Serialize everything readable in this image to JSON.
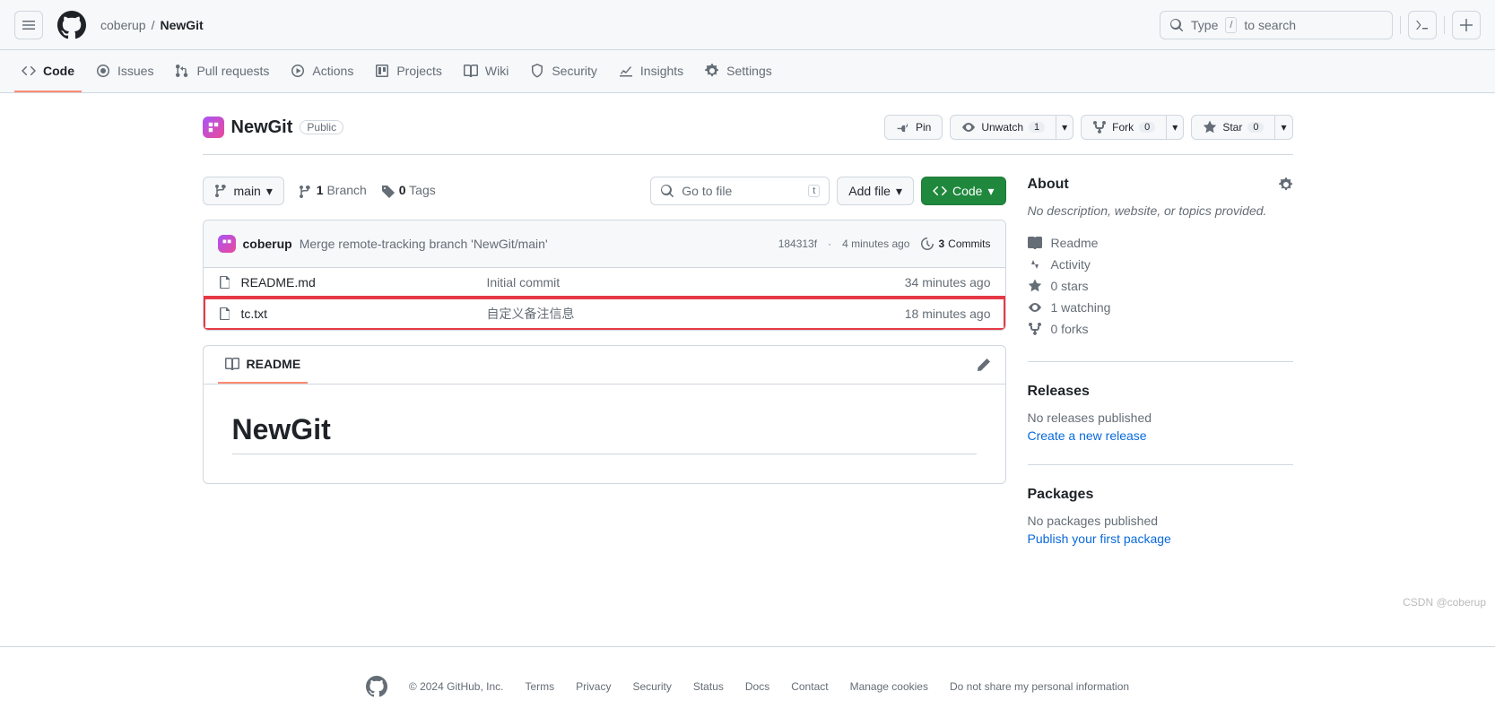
{
  "header": {
    "owner": "coberup",
    "repo": "NewGit",
    "search_placeholder": "Type",
    "search_hint": "to search",
    "search_kbd": "/"
  },
  "tabs": {
    "code": "Code",
    "issues": "Issues",
    "pulls": "Pull requests",
    "actions": "Actions",
    "projects": "Projects",
    "wiki": "Wiki",
    "security": "Security",
    "insights": "Insights",
    "settings": "Settings"
  },
  "repo": {
    "name": "NewGit",
    "visibility": "Public"
  },
  "repoActions": {
    "pin": "Pin",
    "unwatch": "Unwatch",
    "unwatch_count": "1",
    "fork": "Fork",
    "fork_count": "0",
    "star": "Star",
    "star_count": "0"
  },
  "branchBar": {
    "branch": "main",
    "branches_count": "1",
    "branches_label": "Branch",
    "tags_count": "0",
    "tags_label": "Tags",
    "goto_placeholder": "Go to file",
    "goto_kbd": "t",
    "add_file": "Add file",
    "code_btn": "Code"
  },
  "commitBar": {
    "author": "coberup",
    "message": "Merge remote-tracking branch 'NewGit/main'",
    "sha": "184313f",
    "time": "4 minutes ago",
    "commits_count": "3",
    "commits_label": "Commits"
  },
  "files": [
    {
      "name": "README.md",
      "message": "Initial commit",
      "time": "34 minutes ago",
      "highlight": false
    },
    {
      "name": "tc.txt",
      "message": "自定义备注信息",
      "time": "18 minutes ago",
      "highlight": true
    }
  ],
  "readme": {
    "tab_label": "README",
    "heading": "NewGit"
  },
  "sidebar": {
    "about_title": "About",
    "about_desc": "No description, website, or topics provided.",
    "links": {
      "readme": "Readme",
      "activity": "Activity",
      "stars": "0 stars",
      "watching": "1 watching",
      "forks": "0 forks"
    },
    "releases_title": "Releases",
    "releases_empty": "No releases published",
    "releases_action": "Create a new release",
    "packages_title": "Packages",
    "packages_empty": "No packages published",
    "packages_action": "Publish your first package"
  },
  "footer": {
    "copyright": "© 2024 GitHub, Inc.",
    "links": [
      "Terms",
      "Privacy",
      "Security",
      "Status",
      "Docs",
      "Contact",
      "Manage cookies",
      "Do not share my personal information"
    ]
  },
  "watermark": "CSDN @coberup"
}
